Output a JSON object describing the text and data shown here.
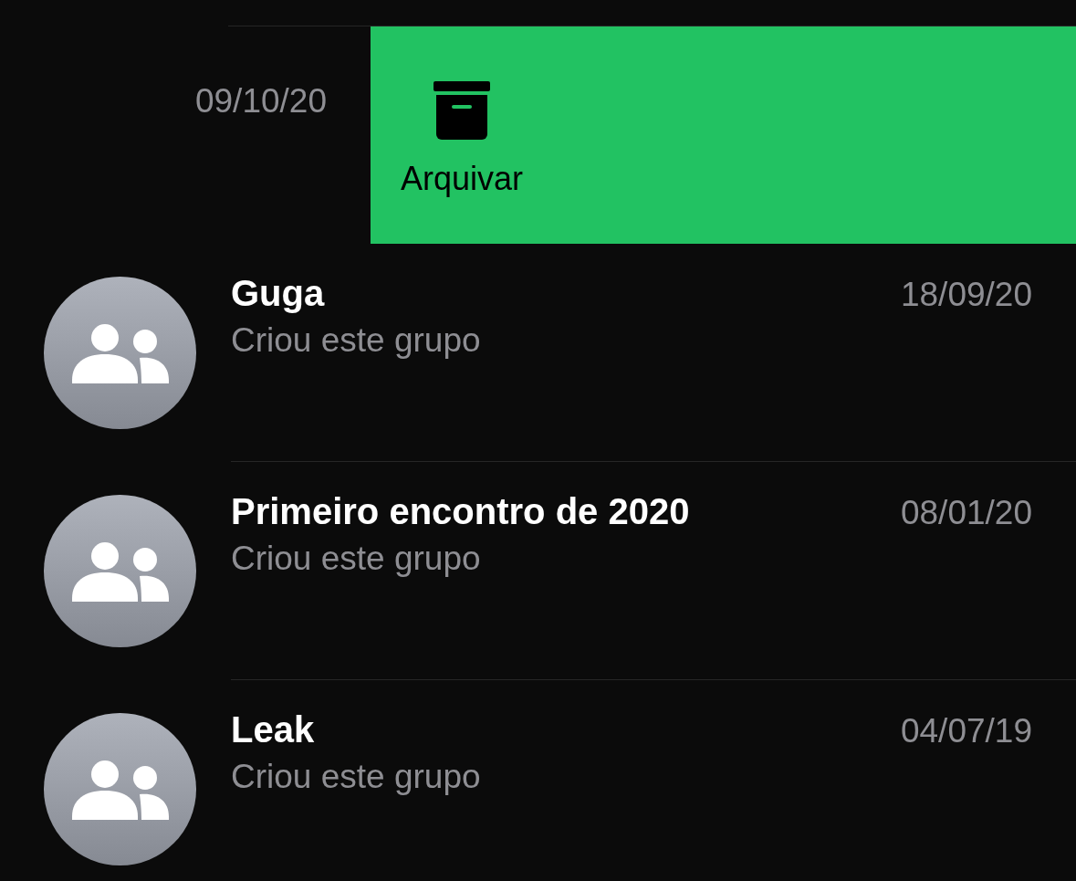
{
  "swiped_row": {
    "date": "09/10/20",
    "action": {
      "label": "Arquivar"
    }
  },
  "chats": [
    {
      "name": "Guga",
      "preview": "Criou este grupo",
      "date": "18/09/20"
    },
    {
      "name": "Primeiro encontro de 2020",
      "preview": "Criou este grupo",
      "date": "08/01/20"
    },
    {
      "name": "Leak",
      "preview": "Criou este grupo",
      "date": "04/07/19"
    }
  ]
}
